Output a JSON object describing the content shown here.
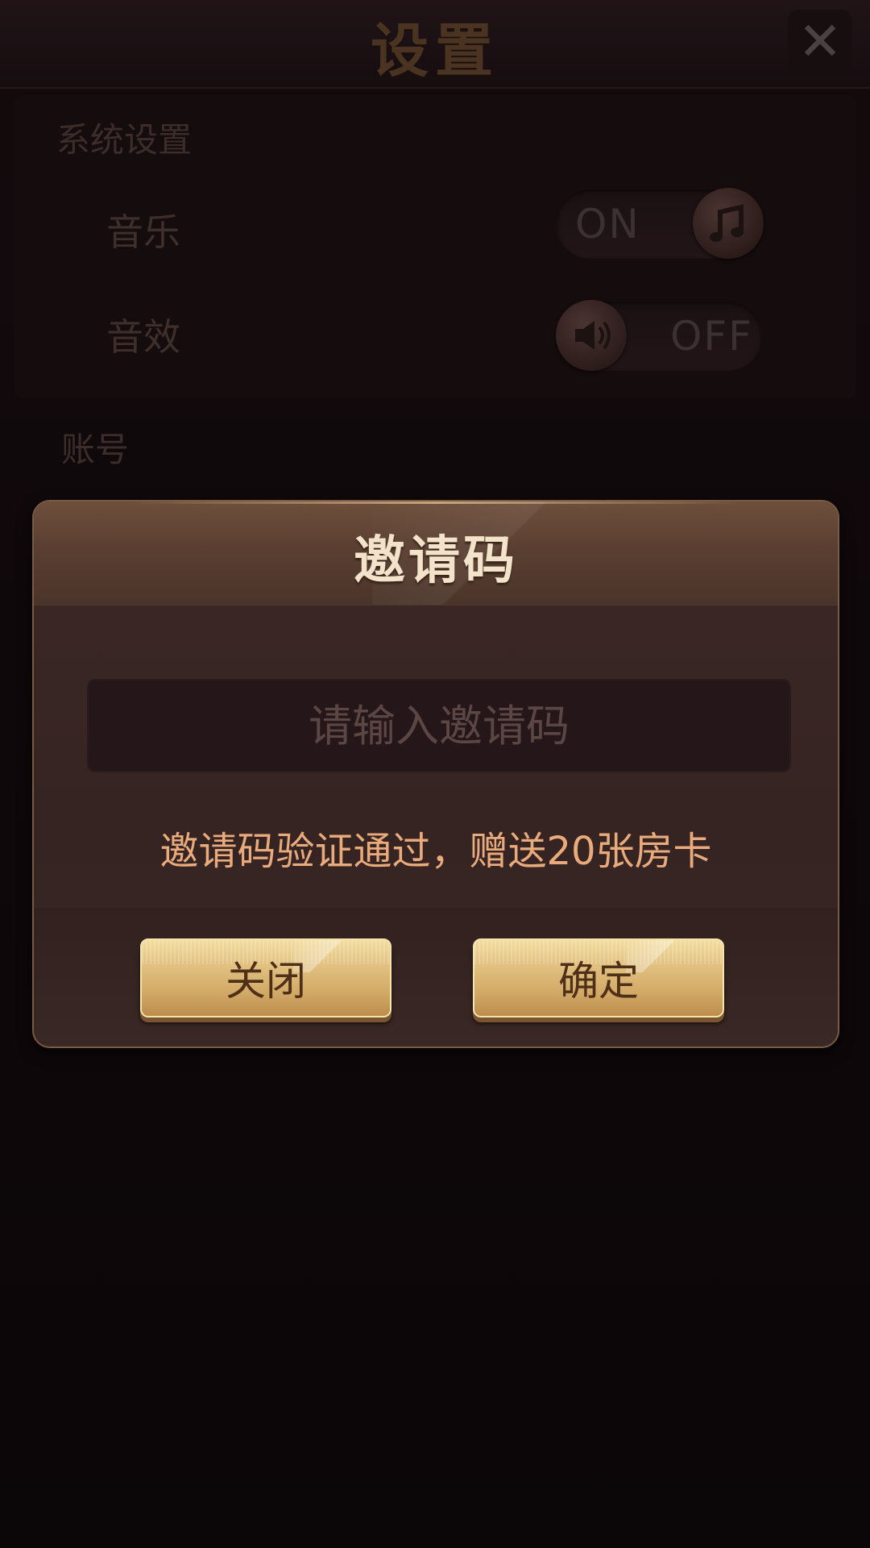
{
  "settings": {
    "title": "设置",
    "close_icon": "close-x-icon",
    "system_section": "系统设置",
    "music": {
      "label": "音乐",
      "state": "ON",
      "icon": "music-note-icon"
    },
    "sound": {
      "label": "音效",
      "state": "OFF",
      "icon": "speaker-icon"
    },
    "account_section": "账号"
  },
  "dialog": {
    "title": "邀请码",
    "input_placeholder": "请输入邀请码",
    "input_value": "",
    "reward_text": "邀请码验证通过，赠送20张房卡",
    "close_button": "关闭",
    "confirm_button": "确定"
  },
  "colors": {
    "accent_gold": "#d9b46f",
    "reward_text": "#e9aa7c",
    "dialog_bg": "#3a2826"
  }
}
